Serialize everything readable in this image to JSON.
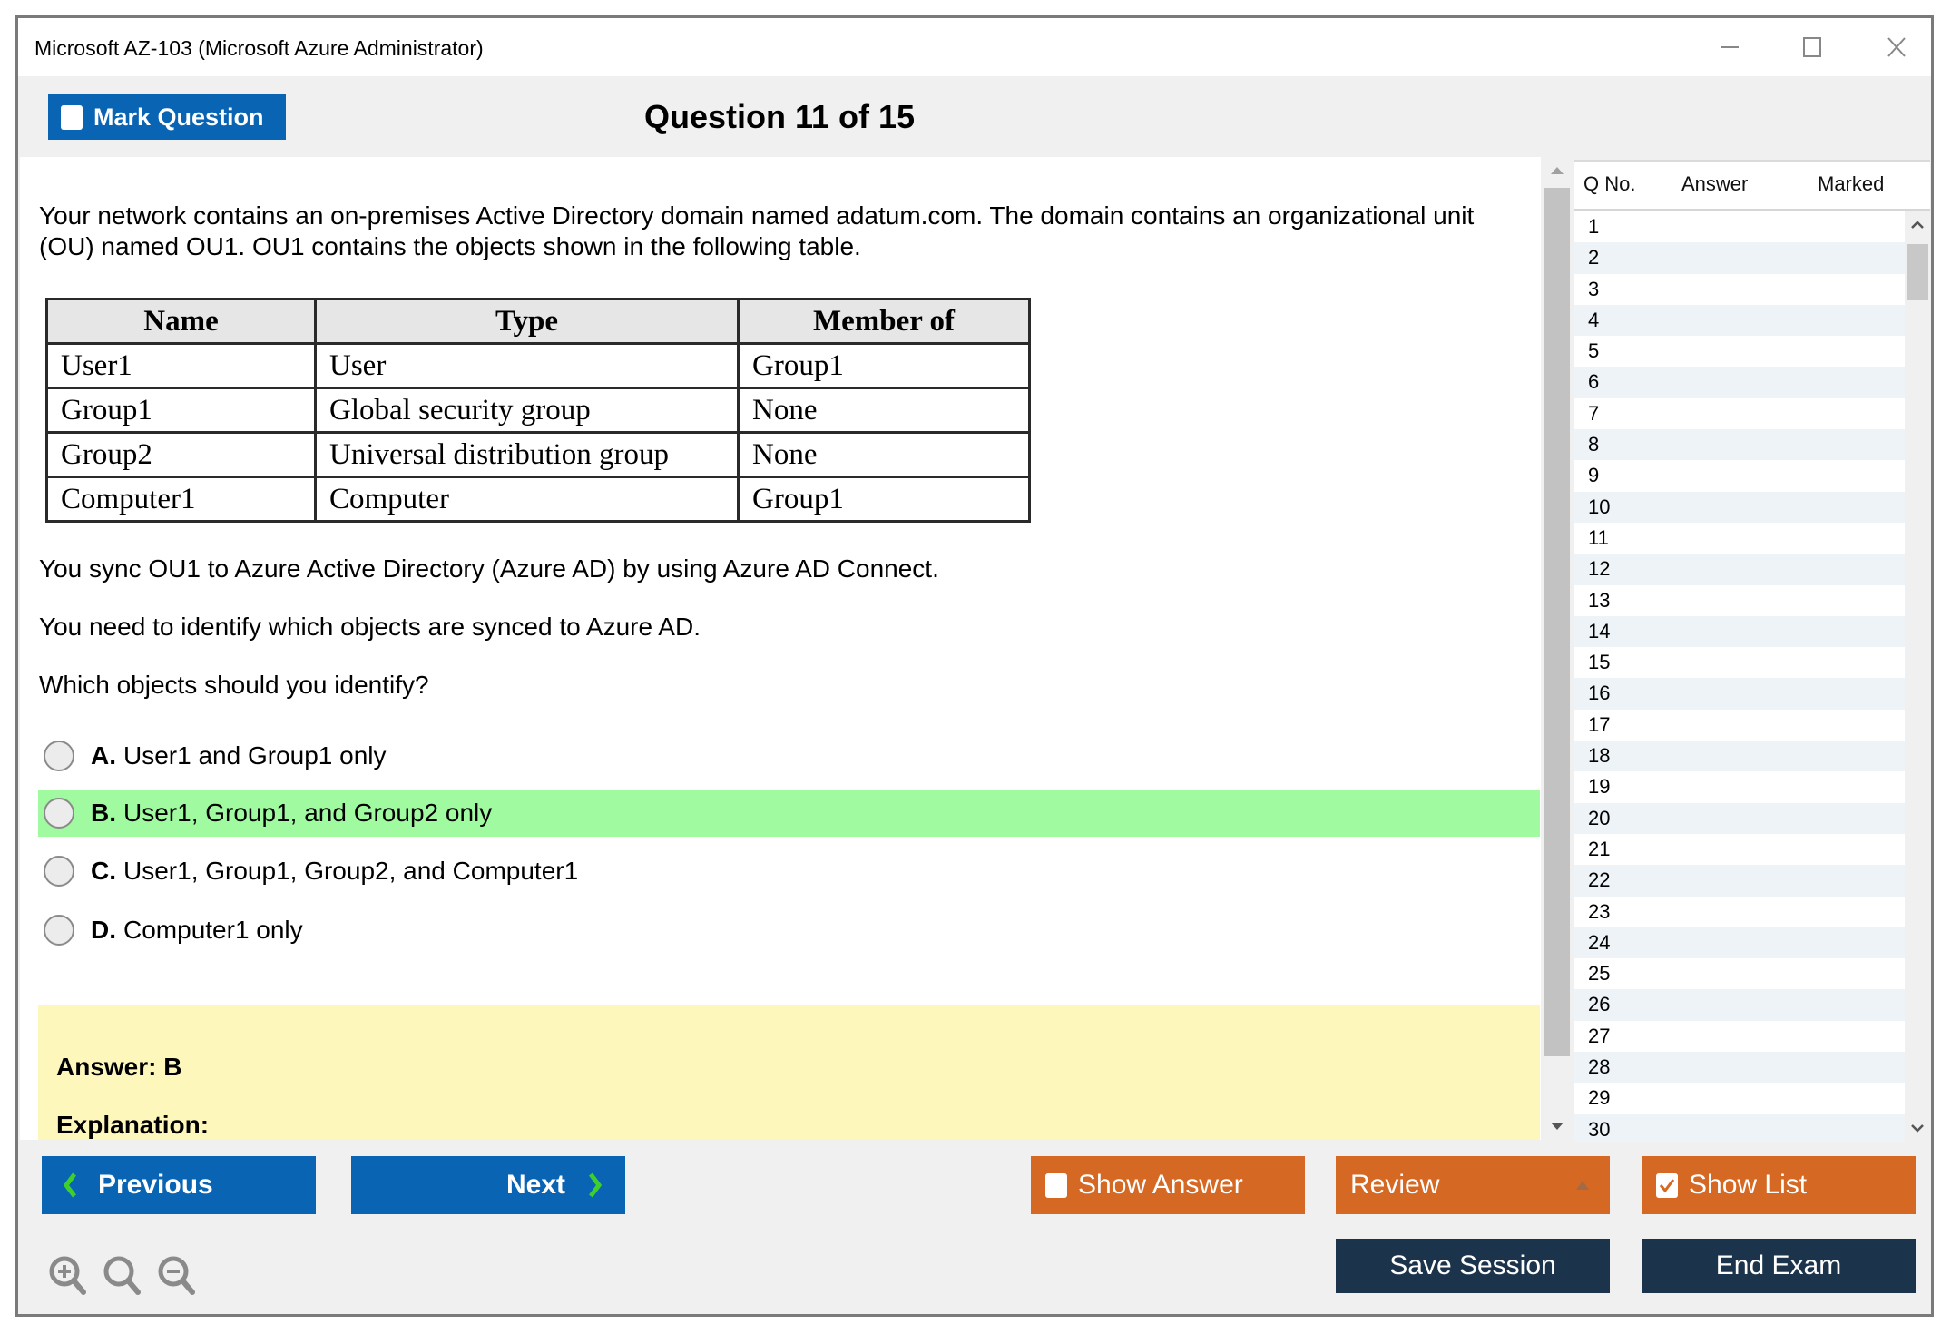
{
  "window": {
    "title": "Microsoft AZ-103 (Microsoft Azure Administrator)",
    "controls": [
      "minimize",
      "maximize",
      "close"
    ]
  },
  "header": {
    "mark_question_label": "Mark Question",
    "mark_question_checked": false,
    "question_title": "Question 11 of 15"
  },
  "question": {
    "intro": "Your network contains an on-premises Active Directory domain named adatum.com. The domain contains an organizational unit (OU) named OU1. OU1 contains the objects shown in the following table.",
    "table": {
      "headers": [
        "Name",
        "Type",
        "Member of"
      ],
      "rows": [
        [
          "User1",
          "User",
          "Group1"
        ],
        [
          "Group1",
          "Global security group",
          "None"
        ],
        [
          "Group2",
          "Universal distribution group",
          "None"
        ],
        [
          "Computer1",
          "Computer",
          "Group1"
        ]
      ]
    },
    "para1": "You sync OU1 to Azure Active Directory (Azure AD) by using Azure AD Connect.",
    "para2": "You need to identify which objects are synced to Azure AD.",
    "prompt": "Which objects should you identify?",
    "options": [
      {
        "letter": "A.",
        "text": "User1 and Group1 only",
        "correct": false
      },
      {
        "letter": "B.",
        "text": "User1, Group1, and Group2 only",
        "correct": true
      },
      {
        "letter": "C.",
        "text": "User1, Group1, Group2, and Computer1",
        "correct": false
      },
      {
        "letter": "D.",
        "text": "Computer1 only",
        "correct": false
      }
    ],
    "answer_label": "Answer: B",
    "explanation_label": "Explanation:"
  },
  "colors": {
    "primary_blue": "#0a64b4",
    "orange": "#d56822",
    "navy": "#1b344b",
    "correct_green": "#a0fba0",
    "answer_yellow": "#fdf7bb",
    "nav_arrow_green": "#3ecf2b"
  },
  "question_list": {
    "columns": [
      "Q No.",
      "Answer",
      "Marked"
    ],
    "rows": [
      "1",
      "2",
      "3",
      "4",
      "5",
      "6",
      "7",
      "8",
      "9",
      "10",
      "11",
      "12",
      "13",
      "14",
      "15",
      "16",
      "17",
      "18",
      "19",
      "20",
      "21",
      "22",
      "23",
      "24",
      "25",
      "26",
      "27",
      "28",
      "29",
      "30"
    ]
  },
  "footer": {
    "previous_label": "Previous",
    "next_label": "Next",
    "show_answer_label": "Show Answer",
    "show_answer_checked": false,
    "review_label": "Review",
    "show_list_label": "Show List",
    "show_list_checked": true,
    "save_session_label": "Save Session",
    "end_exam_label": "End Exam",
    "zoom_icons": [
      "zoom-in-icon",
      "zoom-reset-icon",
      "zoom-out-icon"
    ]
  }
}
